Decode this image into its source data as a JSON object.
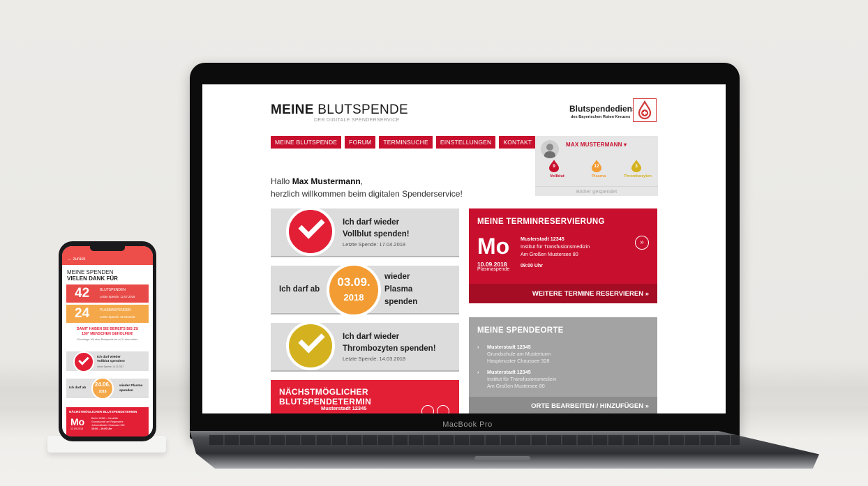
{
  "laptop": {
    "brand": "MacBook Pro"
  },
  "site": {
    "logo_bold": "MEINE",
    "logo_light": "BLUTSPENDE",
    "logo_sub": "DER DIGITALE SPENDERSERVICE",
    "org_name": "Blutspendedienst",
    "org_sub": "des Bayerischen Roten Kreuzes",
    "nav": [
      "MEINE BLUTSPENDE",
      "FORUM",
      "TERMINSUCHE",
      "EINSTELLUNGEN",
      "KONTAKT"
    ],
    "profile": {
      "name": "MAX MUSTERMANN",
      "stats": [
        {
          "count": "9",
          "label": "Vollblut",
          "color": "#c8102e"
        },
        {
          "count": "12",
          "label": "Plasma",
          "color": "#f39c34"
        },
        {
          "count": "3",
          "label": "Thrombozyten",
          "color": "#d4b21f"
        }
      ],
      "footer": "Bisher gespendet"
    },
    "greeting": {
      "hello": "Hallo",
      "name": "Max Mustermann",
      "comma": ",",
      "line2": "herzlich willkommen beim digitalen Spenderservice!"
    },
    "cards": {
      "vollblut": {
        "line1": "Ich darf wieder",
        "line2": "Vollblut spenden!",
        "sub": "Letzte Spende: 17.04.2018"
      },
      "plasma": {
        "prefix": "Ich darf ab",
        "date": "03.09.",
        "year": "2018",
        "line1": "wieder",
        "line2": "Plasma",
        "line3": "spenden"
      },
      "thrombo": {
        "line1": "Ich darf wieder",
        "line2": "Thrombozyten spenden!",
        "sub": "Letzte Spende: 14.03.2018"
      }
    },
    "next_termin": {
      "title": "NÄCHSTMÖGLICHER BLUTSPENDETERMIN",
      "city": "Musterstadt 12345"
    },
    "reservierung": {
      "title": "MEINE TERMINRESERVIERUNG",
      "day": "Mo",
      "city": "Musterstadt 12345",
      "place": "Institut für Transfusionsmedizin",
      "street": "Am Großen Mustersee 80",
      "date": "10.09.2018",
      "kind": "Plasmaspende",
      "time": "09:00 Uhr",
      "button": "WEITERE TERMINE RESERVIEREN  »"
    },
    "spendeorte": {
      "title": "MEINE SPENDEORTE",
      "items": [
        {
          "city": "Musterstadt 12345",
          "place": "Grundschule am Musterturm",
          "street": "Hauptmuster Chaussee 328"
        },
        {
          "city": "Musterstadt 12345",
          "place": "Institut für Transfusionsmedizin",
          "street": "Am Großen Mustersee 80"
        }
      ],
      "button": "ORTE BEARBEITEN / HINZUFÜGEN  »"
    }
  },
  "phone": {
    "back": "zurück",
    "h1": "MEINE SPENDEN",
    "h2": "VIELEN DANK FÜR",
    "stats": [
      {
        "num": "42",
        "label": "BLUTSPENDEN",
        "sub": "Letzte Spende: 12.07.2018",
        "color": "#e84a47"
      },
      {
        "num": "24",
        "label": "PLASMASPENDEN",
        "sub": "Letzte Spende: 01.06.2018",
        "color": "#f5a84a"
      }
    ],
    "saved_line1": "DAMIT HABEN SIE BEREITS BIS ZU",
    "saved_line2": "150* MENSCHEN GEHOLFEN!",
    "footnote": "*Grundlage: Mit einer Blutspende bis zu 3 Leben retten.",
    "card1_line1": "Ich darf wieder",
    "card1_line2": "Vollblut spenden!",
    "card1_sub": "Letzte Spende: 14.12.2017",
    "card2_prefix": "Ich darf ab",
    "card2_date": "24.06.",
    "card2_year": "2018",
    "card2_line1": "wieder Plasma",
    "card2_line2": "spenden",
    "next_title": "NÄCHSTMÖGLICHER BLUTSPENDETERMIN",
    "next_day": "Mo",
    "next_date": "12.09.2018",
    "next_line1": "Berlin 10365 – Neukölln",
    "next_line2": "Grundschule am Regenwehr",
    "next_line3": "Johannisthaler Chaussee 328",
    "next_line4": "15:00 – 19:00 Uhr"
  }
}
